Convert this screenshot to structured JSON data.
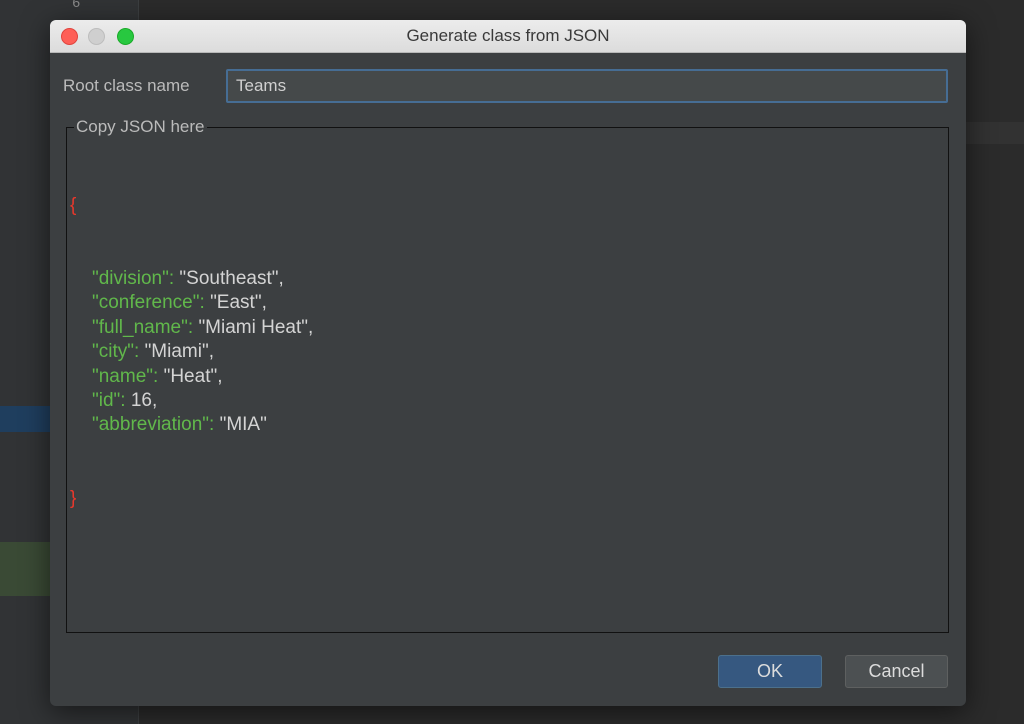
{
  "ide": {
    "line_number": "6"
  },
  "dialog": {
    "title": "Generate class from JSON",
    "root_class_label": "Root class name",
    "root_class_value": "Teams",
    "json_group_label": "Copy JSON here",
    "json_open_brace": "{",
    "json_close_brace": "}",
    "json_entries": [
      {
        "key": "\"division\"",
        "value": "\"Southeast\","
      },
      {
        "key": "\"conference\"",
        "value": "\"East\","
      },
      {
        "key": "\"full_name\"",
        "value": "\"Miami Heat\","
      },
      {
        "key": "\"city\"",
        "value": "\"Miami\","
      },
      {
        "key": "\"name\"",
        "value": "\"Heat\","
      },
      {
        "key": "\"id\"",
        "value": "16,"
      },
      {
        "key": "\"abbreviation\"",
        "value": "\"MIA\""
      }
    ],
    "ok_label": "OK",
    "cancel_label": "Cancel"
  },
  "colors": {
    "json_key": "#61b84b",
    "json_brace": "#e8382c",
    "ok_button": "#365880",
    "focus_border": "#466d94"
  }
}
